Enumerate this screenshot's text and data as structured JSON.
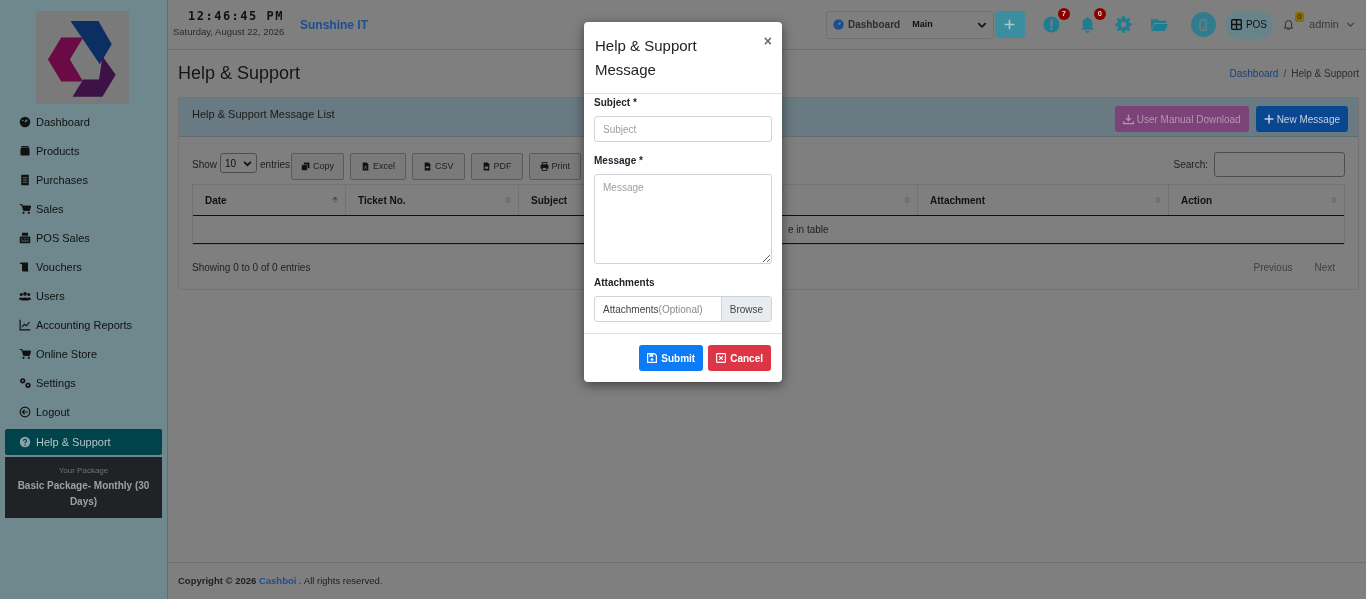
{
  "header": {
    "time": "12:46:45 PM",
    "date": "Saturday, August 22, 2026",
    "company": "Sunshine IT",
    "dashboard_select": {
      "label": "Dashboard",
      "value": "Main"
    },
    "icons": [
      {
        "kind": "plus"
      },
      {
        "kind": "alert",
        "badge": "7"
      },
      {
        "kind": "bell",
        "badge": "0"
      },
      {
        "kind": "gear"
      },
      {
        "kind": "folder"
      },
      {
        "kind": "phone"
      }
    ],
    "pos_label": "POS",
    "notice_badge": "0",
    "user": "admin"
  },
  "sidebar": {
    "items": [
      {
        "label": "Dashboard",
        "selected": false
      },
      {
        "label": "Products",
        "selected": false
      },
      {
        "label": "Purchases",
        "selected": false
      },
      {
        "label": "Sales",
        "selected": false
      },
      {
        "label": "POS Sales",
        "selected": false
      },
      {
        "label": "Vouchers",
        "selected": false
      },
      {
        "label": "Users",
        "selected": false
      },
      {
        "label": "Accounting Reports",
        "selected": false
      },
      {
        "label": "Online Store",
        "selected": false
      },
      {
        "label": "Settings",
        "selected": false
      },
      {
        "label": "Logout",
        "selected": false
      },
      {
        "label": "Help & Support",
        "selected": true
      }
    ],
    "package": {
      "caption": "Your Package",
      "name": "Basic Package- Monthly (30 Days)"
    }
  },
  "page": {
    "title": "Help & Support",
    "breadcrumb": [
      "Dashboard",
      "/",
      "Help & Support"
    ]
  },
  "card": {
    "title": "Help & Support Message List",
    "buttons": [
      {
        "kind": "download",
        "label": "User Manual Download"
      },
      {
        "kind": "new",
        "label": "New Message"
      }
    ],
    "length": {
      "show": "Show",
      "value": "10",
      "entries": "entries"
    },
    "export_buttons": [
      {
        "kind": "copy",
        "label": "Copy"
      },
      {
        "kind": "excel",
        "label": "Excel"
      },
      {
        "kind": "csv",
        "label": "CSV"
      },
      {
        "kind": "pdf",
        "label": "PDF"
      },
      {
        "kind": "print",
        "label": "Print"
      }
    ],
    "search_label": "Search:",
    "table": {
      "columns": [
        {
          "label": "Date",
          "sorted": true
        },
        {
          "label": "Ticket No.",
          "sorted": false
        },
        {
          "label": "Subject"
        },
        {
          "sorted": false
        },
        {
          "label": "Attachment",
          "sorted": false
        },
        {
          "label": "Action",
          "sorted": false
        }
      ],
      "empty_text": "e in table"
    },
    "info": "Showing 0 to 0 of 0 entries",
    "pagination": [
      "Previous",
      "Next"
    ]
  },
  "footer": {
    "prefix": "Copyright © 2026",
    "brand": "Cashboi",
    "suffix": ". All rights reserved."
  },
  "modal": {
    "title": "Help & Support Message",
    "close": "×",
    "fields": [
      {
        "kind": "text",
        "label": "Subject *",
        "placeholder": "Subject"
      },
      {
        "kind": "textarea",
        "label": "Message *",
        "placeholder": "Message"
      },
      {
        "kind": "file",
        "label": "Attachments",
        "placeholder": "Attachments",
        "hint": "(Optional)",
        "button": "Browse"
      }
    ],
    "buttons": [
      {
        "kind": "submit",
        "label": "Submit"
      },
      {
        "kind": "cancel",
        "label": "Cancel"
      }
    ]
  }
}
